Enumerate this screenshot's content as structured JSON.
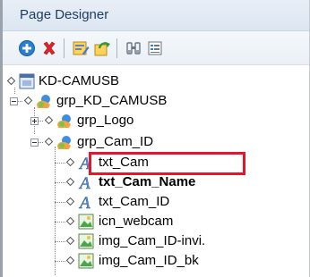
{
  "panel": {
    "title": "Page Designer"
  },
  "toolbar": {
    "buttons": [
      {
        "name": "add-button",
        "icon": "add-circle-icon"
      },
      {
        "name": "delete-button",
        "icon": "delete-x-icon"
      },
      {
        "name": "edit-button",
        "icon": "edit-page-icon"
      },
      {
        "name": "refresh-button",
        "icon": "refresh-icon"
      },
      {
        "name": "find-button",
        "icon": "binoculars-icon"
      },
      {
        "name": "properties-button",
        "icon": "list-icon"
      }
    ]
  },
  "tree": {
    "root": {
      "label": "KD-CAMUSB",
      "icon": "page-icon"
    },
    "group": {
      "label": "grp_KD_CAMUSB",
      "icon": "group-icon"
    },
    "logo_group": {
      "label": "grp_Logo",
      "icon": "group-icon"
    },
    "cam_group": {
      "label": "grp_Cam_ID",
      "icon": "group-icon"
    },
    "items": [
      {
        "label": "txt_Cam",
        "icon": "text-icon"
      },
      {
        "label": "txt_Cam_Name",
        "icon": "text-icon",
        "selected": true
      },
      {
        "label": "txt_Cam_ID",
        "icon": "text-icon"
      },
      {
        "label": "icn_webcam",
        "icon": "image-icon"
      },
      {
        "label": "img_Cam_ID-invi.",
        "icon": "image-icon"
      },
      {
        "label": "img_Cam_ID_bk",
        "icon": "image-icon"
      }
    ]
  },
  "colors": {
    "highlight": "#e3162a",
    "title_text": "#1e3b5d"
  }
}
